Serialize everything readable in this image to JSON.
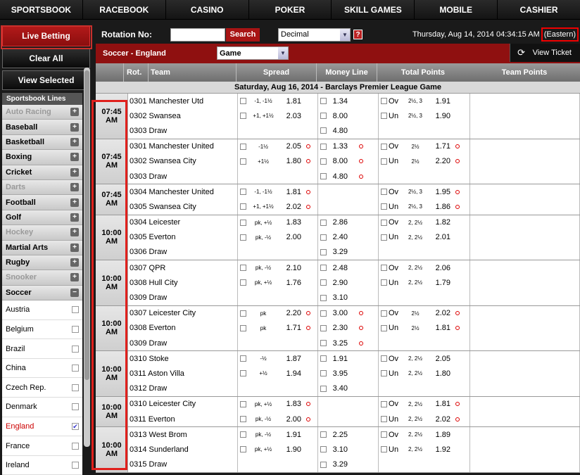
{
  "nav": [
    "SPORTSBOOK",
    "RACEBOOK",
    "CASINO",
    "POKER",
    "SKILL GAMES",
    "MOBILE",
    "CASHIER"
  ],
  "sidebar": {
    "live_betting": "Live Betting",
    "clear_all": "Clear All",
    "view_selected": "View Selected",
    "lines_header": "Sportsbook Lines",
    "sports": [
      {
        "label": "Auto Racing",
        "dim": true
      },
      {
        "label": "Baseball",
        "dim": false
      },
      {
        "label": "Basketball",
        "dim": false
      },
      {
        "label": "Boxing",
        "dim": false
      },
      {
        "label": "Cricket",
        "dim": false
      },
      {
        "label": "Darts",
        "dim": true
      },
      {
        "label": "Football",
        "dim": false
      },
      {
        "label": "Golf",
        "dim": false
      },
      {
        "label": "Hockey",
        "dim": true
      },
      {
        "label": "Martial Arts",
        "dim": false
      },
      {
        "label": "Rugby",
        "dim": false
      },
      {
        "label": "Snooker",
        "dim": true
      },
      {
        "label": "Soccer",
        "dim": false,
        "expanded": true
      }
    ],
    "countries": [
      {
        "label": "Austria",
        "checked": false
      },
      {
        "label": "Belgium",
        "checked": false
      },
      {
        "label": "Brazil",
        "checked": false
      },
      {
        "label": "China",
        "checked": false
      },
      {
        "label": "Czech Rep.",
        "checked": false
      },
      {
        "label": "Denmark",
        "checked": false
      },
      {
        "label": "England",
        "checked": true
      },
      {
        "label": "France",
        "checked": false
      },
      {
        "label": "Ireland",
        "checked": false
      }
    ]
  },
  "toolbar": {
    "rotation_label": "Rotation No:",
    "search_label": "Search",
    "odds_format": "Decimal",
    "datetime": "Thursday, Aug 14, 2014 04:34:15 AM",
    "timezone": "(Eastern)"
  },
  "subhead": {
    "league": "Soccer - England",
    "market": "Game",
    "view_ticket": "View Ticket"
  },
  "columns": {
    "rot": "Rot.",
    "team": "Team",
    "spread": "Spread",
    "money_line": "Money Line",
    "total_points": "Total Points",
    "team_points": "Team Points"
  },
  "date_header": "Saturday, Aug 16, 2014 - Barclays Premier League Game",
  "groups": [
    {
      "time": "07:45 AM",
      "rows": [
        {
          "team": "0301 Manchester Utd",
          "hcp": "-1, -1½",
          "sp": "1.81",
          "ml": "1.34",
          "ou": "Ov",
          "tl": "2½, 3",
          "tp": "1.91",
          "dots": false
        },
        {
          "team": "0302 Swansea",
          "hcp": "+1, +1½",
          "sp": "2.03",
          "ml": "8.00",
          "ou": "Un",
          "tl": "2½, 3",
          "tp": "1.90",
          "dots": false
        },
        {
          "team": "0303 Draw",
          "hcp": "",
          "sp": "",
          "ml": "4.80",
          "ou": "",
          "tl": "",
          "tp": "",
          "dots": false
        }
      ]
    },
    {
      "time": "07:45 AM",
      "rows": [
        {
          "team": "0301 Manchester United",
          "hcp": "-1½",
          "sp": "2.05",
          "ml": "1.33",
          "ou": "Ov",
          "tl": "2½",
          "tp": "1.71",
          "dots": true
        },
        {
          "team": "0302 Swansea City",
          "hcp": "+1½",
          "sp": "1.80",
          "ml": "8.00",
          "ou": "Un",
          "tl": "2½",
          "tp": "2.20",
          "dots": true
        },
        {
          "team": "0303 Draw",
          "hcp": "",
          "sp": "",
          "ml": "4.80",
          "ou": "",
          "tl": "",
          "tp": "",
          "dots": true
        }
      ]
    },
    {
      "time": "07:45 AM",
      "rows": [
        {
          "team": "0304 Manchester United",
          "hcp": "-1, -1½",
          "sp": "1.81",
          "ml": "",
          "ou": "Ov",
          "tl": "2½, 3",
          "tp": "1.95",
          "dots": true
        },
        {
          "team": "0305 Swansea City",
          "hcp": "+1, +1½",
          "sp": "2.02",
          "ml": "",
          "ou": "Un",
          "tl": "2½, 3",
          "tp": "1.86",
          "dots": true
        }
      ]
    },
    {
      "time": "10:00 AM",
      "rows": [
        {
          "team": "0304 Leicester",
          "hcp": "pk, +½",
          "sp": "1.83",
          "ml": "2.86",
          "ou": "Ov",
          "tl": "2, 2½",
          "tp": "1.82",
          "dots": false
        },
        {
          "team": "0305 Everton",
          "hcp": "pk, -½",
          "sp": "2.00",
          "ml": "2.40",
          "ou": "Un",
          "tl": "2, 2½",
          "tp": "2.01",
          "dots": false
        },
        {
          "team": "0306 Draw",
          "hcp": "",
          "sp": "",
          "ml": "3.29",
          "ou": "",
          "tl": "",
          "tp": "",
          "dots": false
        }
      ]
    },
    {
      "time": "10:00 AM",
      "rows": [
        {
          "team": "0307 QPR",
          "hcp": "pk, -½",
          "sp": "2.10",
          "ml": "2.48",
          "ou": "Ov",
          "tl": "2, 2½",
          "tp": "2.06",
          "dots": false
        },
        {
          "team": "0308 Hull City",
          "hcp": "pk, +½",
          "sp": "1.76",
          "ml": "2.90",
          "ou": "Un",
          "tl": "2, 2½",
          "tp": "1.79",
          "dots": false
        },
        {
          "team": "0309 Draw",
          "hcp": "",
          "sp": "",
          "ml": "3.10",
          "ou": "",
          "tl": "",
          "tp": "",
          "dots": false
        }
      ]
    },
    {
      "time": "10:00 AM",
      "rows": [
        {
          "team": "0307 Leicester City",
          "hcp": "pk",
          "sp": "2.20",
          "ml": "3.00",
          "ou": "Ov",
          "tl": "2½",
          "tp": "2.02",
          "dots": true
        },
        {
          "team": "0308 Everton",
          "hcp": "pk",
          "sp": "1.71",
          "ml": "2.30",
          "ou": "Un",
          "tl": "2½",
          "tp": "1.81",
          "dots": true
        },
        {
          "team": "0309 Draw",
          "hcp": "",
          "sp": "",
          "ml": "3.25",
          "ou": "",
          "tl": "",
          "tp": "",
          "dots": true
        }
      ]
    },
    {
      "time": "10:00 AM",
      "rows": [
        {
          "team": "0310 Stoke",
          "hcp": "-½",
          "sp": "1.87",
          "ml": "1.91",
          "ou": "Ov",
          "tl": "2, 2½",
          "tp": "2.05",
          "dots": false
        },
        {
          "team": "0311 Aston Villa",
          "hcp": "+½",
          "sp": "1.94",
          "ml": "3.95",
          "ou": "Un",
          "tl": "2, 2½",
          "tp": "1.80",
          "dots": false
        },
        {
          "team": "0312 Draw",
          "hcp": "",
          "sp": "",
          "ml": "3.40",
          "ou": "",
          "tl": "",
          "tp": "",
          "dots": false
        }
      ]
    },
    {
      "time": "10:00 AM",
      "rows": [
        {
          "team": "0310 Leicester City",
          "hcp": "pk, +½",
          "sp": "1.83",
          "ml": "",
          "ou": "Ov",
          "tl": "2, 2½",
          "tp": "1.81",
          "dots": true
        },
        {
          "team": "0311 Everton",
          "hcp": "pk, -½",
          "sp": "2.00",
          "ml": "",
          "ou": "Un",
          "tl": "2, 2½",
          "tp": "2.02",
          "dots": true
        }
      ]
    },
    {
      "time": "10:00 AM",
      "rows": [
        {
          "team": "0313 West Brom",
          "hcp": "pk, -½",
          "sp": "1.91",
          "ml": "2.25",
          "ou": "Ov",
          "tl": "2, 2½",
          "tp": "1.89",
          "dots": false
        },
        {
          "team": "0314 Sunderland",
          "hcp": "pk, +½",
          "sp": "1.90",
          "ml": "3.10",
          "ou": "Un",
          "tl": "2, 2½",
          "tp": "1.92",
          "dots": false
        },
        {
          "team": "0315 Draw",
          "hcp": "",
          "sp": "",
          "ml": "3.29",
          "ou": "",
          "tl": "",
          "tp": "",
          "dots": false
        }
      ]
    }
  ]
}
